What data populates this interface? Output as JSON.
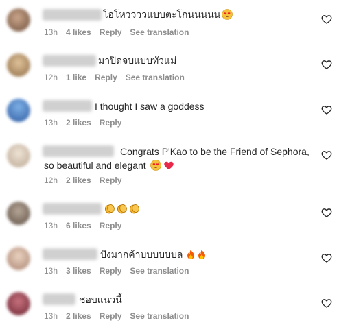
{
  "comments": [
    {
      "text": "โอโหววววแบบตะโกนนนนน",
      "emoji": [
        "heart-eyes"
      ],
      "time": "13h",
      "likes": "4 likes",
      "reply": "Reply",
      "translate": "See translation",
      "avatar_color": "#8a6b52"
    },
    {
      "text": "มาปิดจบแบบทัวแม่",
      "emoji": [],
      "time": "12h",
      "likes": "1 like",
      "reply": "Reply",
      "translate": "See translation",
      "avatar_color": "#b39066"
    },
    {
      "text": "I thought I saw a goddess",
      "emoji": [],
      "time": "13h",
      "likes": "2 likes",
      "reply": "Reply",
      "translate": "",
      "avatar_color": "#3e6fb8"
    },
    {
      "text": "Congrats P'Kao to be the Friend of Sephora,",
      "text2": "so beautiful and elegant",
      "emoji": [
        "heart-eyes",
        "red-heart"
      ],
      "time": "12h",
      "likes": "2 likes",
      "reply": "Reply",
      "translate": "",
      "avatar_color": "#d8c7b4"
    },
    {
      "text": "",
      "emoji": [
        "clap",
        "clap",
        "clap"
      ],
      "time": "13h",
      "likes": "6 likes",
      "reply": "Reply",
      "translate": "",
      "avatar_color": "#7a6a5c"
    },
    {
      "text": "ปังมากค้าบบบบบบล",
      "emoji": [
        "fire",
        "fire"
      ],
      "time": "13h",
      "likes": "3 likes",
      "reply": "Reply",
      "translate": "See translation",
      "avatar_color": "#c9a48c"
    },
    {
      "text": "ชอบแนวนี้",
      "emoji": [],
      "time": "13h",
      "likes": "2 likes",
      "reply": "Reply",
      "translate": "See translation",
      "avatar_color": "#8e3a46"
    }
  ],
  "colors": {
    "text": "#262626",
    "meta": "#8e8e8e",
    "heart_outline": "#262626"
  }
}
